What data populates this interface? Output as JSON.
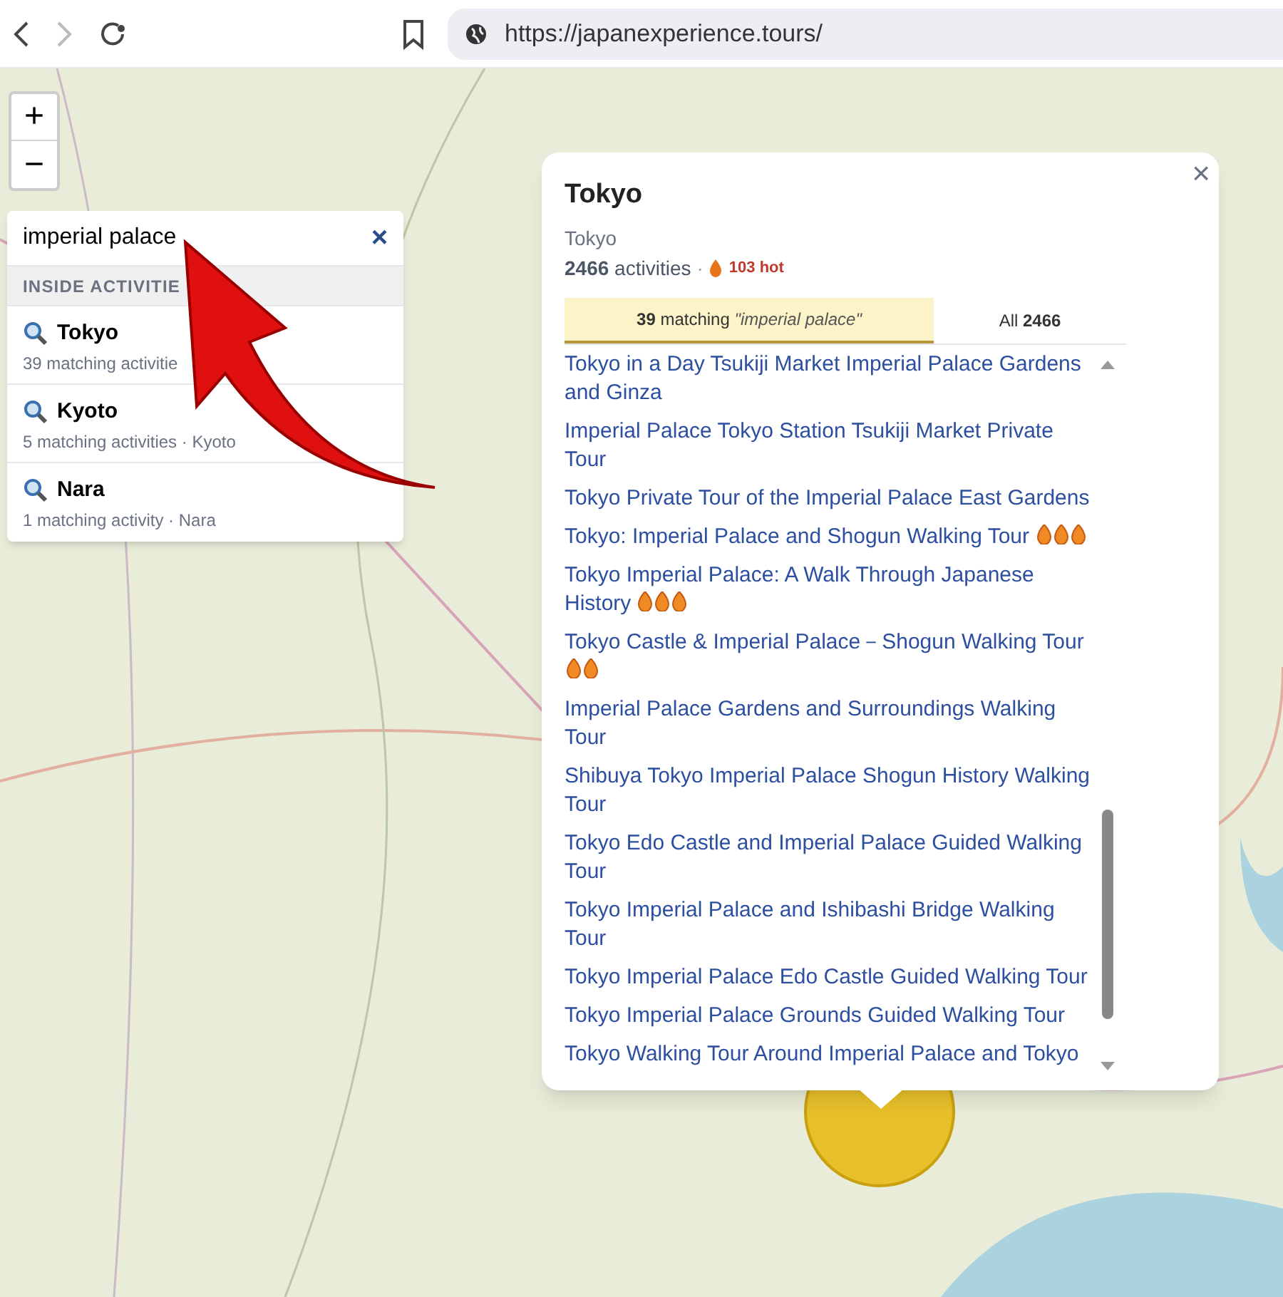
{
  "browser": {
    "url": "https://japanexperience.tours/"
  },
  "zoom_controls": [
    "+",
    "−"
  ],
  "search": {
    "value": "imperial palace",
    "clear": "×",
    "section": "INSIDE ACTIVITIE",
    "results": [
      {
        "title": "Tokyo",
        "detail": "39 matching activitie"
      },
      {
        "title": "Kyoto",
        "detail": "5 matching activities · Kyoto"
      },
      {
        "title": "Nara",
        "detail": "1 matching activity · Nara"
      }
    ]
  },
  "popup": {
    "title": "Tokyo",
    "subtitle": "Tokyo",
    "count": "2466",
    "count_label": "activities",
    "separator": "·",
    "hot": "103 hot",
    "close": "×",
    "tabs": [
      {
        "count": "39",
        "label": "matching",
        "query": "\"imperial palace\"",
        "selected": true
      },
      {
        "count": "2466",
        "label": "All",
        "selected": false
      }
    ],
    "activities": [
      {
        "title": "Tokyo in a Day Tsukiji Market Imperial Palace Gardens and Ginza"
      },
      {
        "title": "Imperial Palace Tokyo Station Tsukiji Market Private Tour"
      },
      {
        "title": "Tokyo Private Tour of the Imperial Palace East Gardens"
      },
      {
        "title": "Tokyo: Imperial Palace and Shogun Walking Tour",
        "icons": [
          {
            "kind": "flame"
          },
          {
            "kind": "flame"
          },
          {
            "kind": "flame"
          }
        ]
      },
      {
        "title": "Tokyo Imperial Palace: A Walk Through Japanese History",
        "icons": [
          {
            "kind": "flame"
          },
          {
            "kind": "flame"
          },
          {
            "kind": "flame"
          }
        ]
      },
      {
        "title": "Tokyo Castle & Imperial Palace－Shogun Walking Tour",
        "icons": [
          {
            "kind": "flame"
          },
          {
            "kind": "flame"
          }
        ]
      },
      {
        "title": "Imperial Palace Gardens and Surroundings Walking Tour"
      },
      {
        "title": "Shibuya Tokyo Imperial Palace Shogun History Walking Tour"
      },
      {
        "title": "Tokyo Edo Castle and Imperial Palace Guided Walking Tour"
      },
      {
        "title": "Tokyo Imperial Palace and Ishibashi Bridge Walking Tour"
      },
      {
        "title": "Tokyo Imperial Palace Edo Castle Guided Walking Tour"
      },
      {
        "title": "Tokyo Imperial Palace Grounds Guided Walking Tour"
      },
      {
        "title": "Tokyo Walking Tour Around Imperial Palace and Tokyo"
      }
    ]
  }
}
